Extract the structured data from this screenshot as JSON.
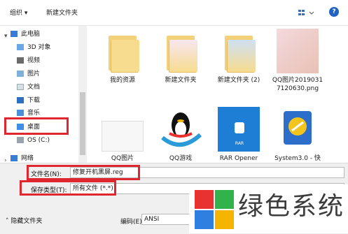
{
  "toolbar": {
    "organize": "组织 ▾",
    "new_folder": "新建文件夹"
  },
  "sidebar": {
    "items": [
      {
        "label": "此电脑"
      },
      {
        "label": "3D 对象"
      },
      {
        "label": "视频"
      },
      {
        "label": "图片"
      },
      {
        "label": "文档"
      },
      {
        "label": "下载"
      },
      {
        "label": "音乐"
      },
      {
        "label": "桌面"
      },
      {
        "label": "OS (C:)"
      },
      {
        "label": "网络"
      }
    ]
  },
  "files": [
    {
      "name": "我的资源"
    },
    {
      "name": "新建文件夹"
    },
    {
      "name": "新建文件夹 (2)"
    },
    {
      "name": "QQ图片20190317120630.png"
    },
    {
      "name": "QQ图片"
    },
    {
      "name": "QQ游戏"
    },
    {
      "name": "RAR Opener"
    },
    {
      "name": "System3.0 - 快"
    }
  ],
  "bottom": {
    "filename_label": "文件名(N):",
    "filename_value": "修复开机黑屏.reg",
    "filetype_label": "保存类型(T):",
    "filetype_value": "所有文件  (*.*)",
    "hide_folders": "隐藏文件夹",
    "encoding_label": "编码(E):",
    "encoding_value": "ANSI"
  },
  "watermark": {
    "text": "绿色系统"
  }
}
